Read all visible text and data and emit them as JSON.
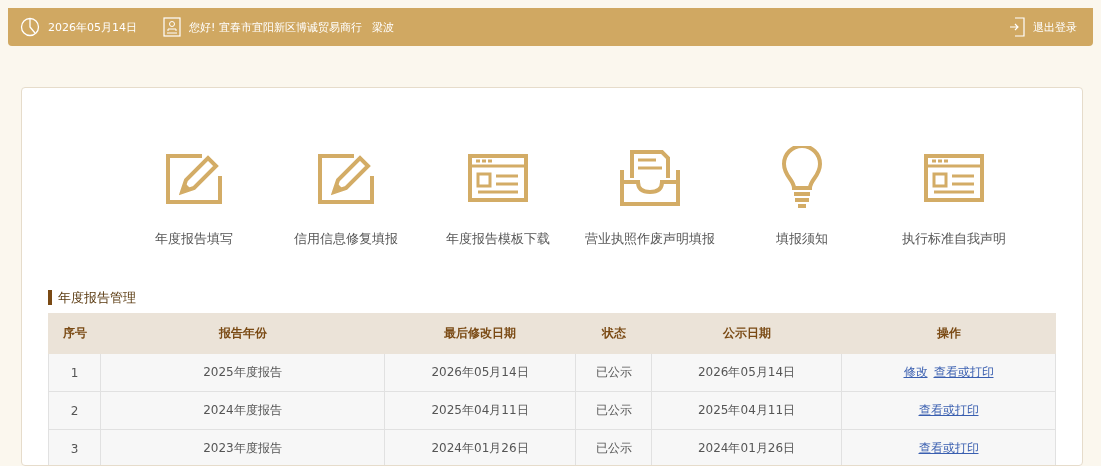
{
  "top_bar": {
    "date": "2026年05月14日",
    "greeting": "您好!  宜春市宜阳新区博诚贸易商行",
    "user": "梁波",
    "logout": "退出登录"
  },
  "shortcuts": [
    {
      "label": "年度报告填写"
    },
    {
      "label": "信用信息修复填报"
    },
    {
      "label": "年度报告模板下载"
    },
    {
      "label": "营业执照作废声明填报"
    },
    {
      "label": "填报须知"
    },
    {
      "label": "执行标准自我声明"
    }
  ],
  "section_title": "年度报告管理",
  "table": {
    "columns": [
      "序号",
      "报告年份",
      "最后修改日期",
      "状态",
      "公示日期",
      "操作"
    ],
    "rows": [
      {
        "cells": [
          "1",
          "2025年度报告",
          "2026年05月14日",
          "已公示",
          "2026年05月14日"
        ],
        "actions": [
          "修改",
          "查看或打印"
        ]
      },
      {
        "cells": [
          "2",
          "2024年度报告",
          "2025年04月11日",
          "已公示",
          "2025年04月11日"
        ],
        "actions": [
          "查看或打印"
        ]
      },
      {
        "cells": [
          "3",
          "2023年度报告",
          "2024年01月26日",
          "已公示",
          "2024年01月26日"
        ],
        "actions": [
          "查看或打印"
        ]
      }
    ]
  }
}
